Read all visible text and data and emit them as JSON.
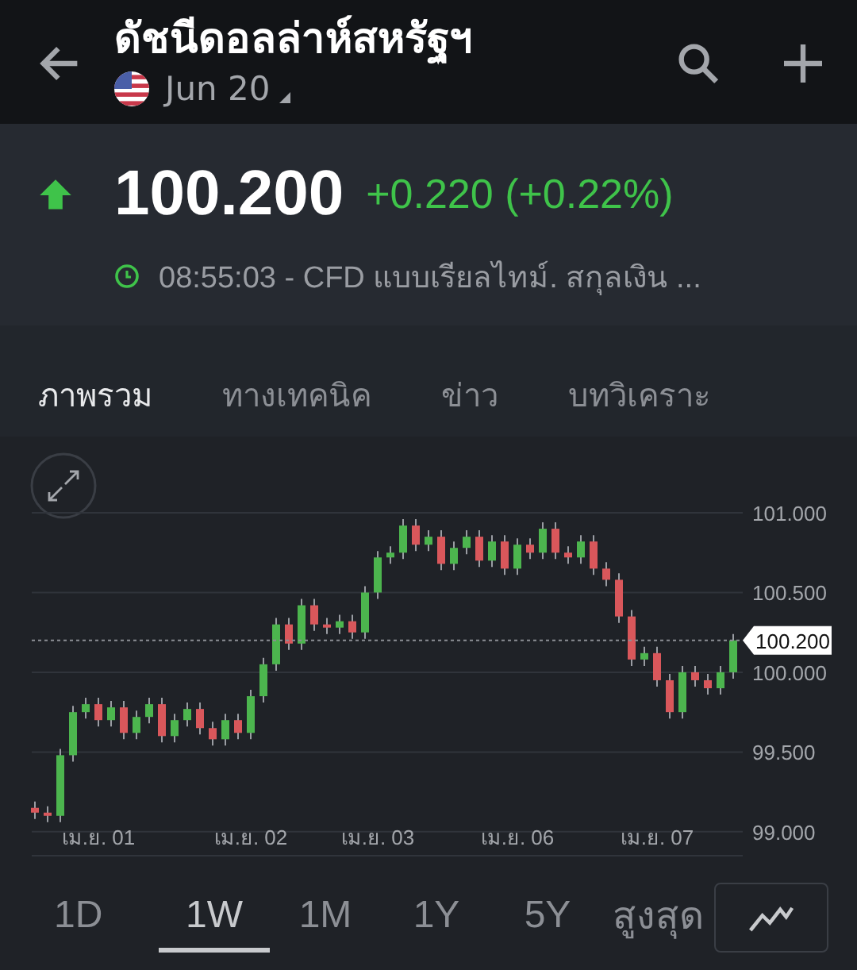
{
  "header": {
    "title": "ดัชนีดอลล่าห์สหรัฐฯ",
    "contract": "Jun 20"
  },
  "quote": {
    "price": "100.200",
    "change": "+0.220 (+0.22%)",
    "up": true,
    "info": "08:55:03 - CFD แบบเรียลไทม์. สกุลเงิน ..."
  },
  "tabs": [
    {
      "label": "ภาพรวม",
      "selected": true
    },
    {
      "label": "ทางเทคนิค",
      "selected": false
    },
    {
      "label": "ข่าว",
      "selected": false
    },
    {
      "label": "บทวิเคราะ",
      "selected": false
    }
  ],
  "chart": {
    "chart_data": {
      "type": "candlestick",
      "grid": true,
      "ylim": [
        98.85,
        101
      ],
      "yticks": [
        {
          "value": 99,
          "label": "99.000"
        },
        {
          "value": 99.5,
          "label": "99.500"
        },
        {
          "value": 100,
          "label": "100.000"
        },
        {
          "value": 100.5,
          "label": "100.500"
        },
        {
          "value": 101,
          "label": "101.000"
        }
      ],
      "categories": [
        null,
        null,
        null,
        null,
        null,
        "เม.ย. 01",
        null,
        null,
        null,
        null,
        null,
        null,
        null,
        null,
        null,
        null,
        null,
        "เม.ย. 02",
        null,
        null,
        null,
        null,
        null,
        null,
        null,
        null,
        null,
        "เม.ย. 03",
        null,
        null,
        null,
        null,
        null,
        null,
        null,
        null,
        null,
        null,
        "เม.ย. 06",
        null,
        null,
        null,
        null,
        null,
        null,
        null,
        null,
        null,
        null,
        "เม.ย. 07",
        null,
        null,
        null,
        null,
        null,
        null
      ],
      "ohlc": [
        [
          99.15,
          99.19,
          99.08,
          99.12
        ],
        [
          99.12,
          99.16,
          99.06,
          99.1
        ],
        [
          99.1,
          99.52,
          99.06,
          99.48
        ],
        [
          99.48,
          99.79,
          99.44,
          99.75
        ],
        [
          99.75,
          99.84,
          99.71,
          99.8
        ],
        [
          99.8,
          99.84,
          99.66,
          99.7
        ],
        [
          99.7,
          99.82,
          99.66,
          99.78
        ],
        [
          99.78,
          99.82,
          99.58,
          99.62
        ],
        [
          99.62,
          99.76,
          99.58,
          99.72
        ],
        [
          99.72,
          99.84,
          99.68,
          99.8
        ],
        [
          99.8,
          99.84,
          99.56,
          99.6
        ],
        [
          99.6,
          99.74,
          99.56,
          99.7
        ],
        [
          99.7,
          99.81,
          99.66,
          99.77
        ],
        [
          99.77,
          99.81,
          99.61,
          99.65
        ],
        [
          99.65,
          99.69,
          99.54,
          99.58
        ],
        [
          99.58,
          99.74,
          99.54,
          99.7
        ],
        [
          99.7,
          99.74,
          99.58,
          99.62
        ],
        [
          99.62,
          99.89,
          99.58,
          99.85
        ],
        [
          99.85,
          100.09,
          99.81,
          100.05
        ],
        [
          100.05,
          100.34,
          100.01,
          100.3
        ],
        [
          100.3,
          100.34,
          100.14,
          100.18
        ],
        [
          100.18,
          100.46,
          100.14,
          100.42
        ],
        [
          100.42,
          100.46,
          100.26,
          100.3
        ],
        [
          100.3,
          100.34,
          100.24,
          100.28
        ],
        [
          100.28,
          100.36,
          100.24,
          100.32
        ],
        [
          100.32,
          100.36,
          100.21,
          100.25
        ],
        [
          100.25,
          100.54,
          100.21,
          100.5
        ],
        [
          100.5,
          100.76,
          100.46,
          100.72
        ],
        [
          100.72,
          100.79,
          100.68,
          100.75
        ],
        [
          100.75,
          100.96,
          100.71,
          100.92
        ],
        [
          100.92,
          100.96,
          100.76,
          100.8
        ],
        [
          100.8,
          100.89,
          100.76,
          100.85
        ],
        [
          100.85,
          100.89,
          100.64,
          100.68
        ],
        [
          100.68,
          100.82,
          100.64,
          100.78
        ],
        [
          100.78,
          100.89,
          100.74,
          100.85
        ],
        [
          100.85,
          100.89,
          100.66,
          100.7
        ],
        [
          100.7,
          100.86,
          100.66,
          100.82
        ],
        [
          100.82,
          100.86,
          100.61,
          100.65
        ],
        [
          100.65,
          100.84,
          100.61,
          100.8
        ],
        [
          100.8,
          100.84,
          100.71,
          100.75
        ],
        [
          100.75,
          100.94,
          100.71,
          100.9
        ],
        [
          100.9,
          100.94,
          100.71,
          100.75
        ],
        [
          100.75,
          100.79,
          100.68,
          100.72
        ],
        [
          100.72,
          100.86,
          100.68,
          100.82
        ],
        [
          100.82,
          100.86,
          100.61,
          100.65
        ],
        [
          100.65,
          100.69,
          100.54,
          100.58
        ],
        [
          100.58,
          100.62,
          100.31,
          100.35
        ],
        [
          100.35,
          100.39,
          100.04,
          100.08
        ],
        [
          100.08,
          100.16,
          100.04,
          100.12
        ],
        [
          100.12,
          100.16,
          99.91,
          99.95
        ],
        [
          99.95,
          99.99,
          99.71,
          99.75
        ],
        [
          99.75,
          100.04,
          99.71,
          100.0
        ],
        [
          100.0,
          100.04,
          99.91,
          99.95
        ],
        [
          99.95,
          99.99,
          99.86,
          99.9
        ],
        [
          99.9,
          100.04,
          99.86,
          100.0
        ],
        [
          100.0,
          100.24,
          99.96,
          100.2
        ]
      ],
      "ref_lines": [
        {
          "axis": "y",
          "value": 100.2,
          "label": "100.200"
        }
      ]
    }
  },
  "ranges": [
    {
      "label": "1D",
      "selected": false
    },
    {
      "label": "1W",
      "selected": true
    },
    {
      "label": "1M",
      "selected": false
    },
    {
      "label": "1Y",
      "selected": false
    },
    {
      "label": "5Y",
      "selected": false
    },
    {
      "label": "สูงสุด",
      "selected": false
    }
  ]
}
